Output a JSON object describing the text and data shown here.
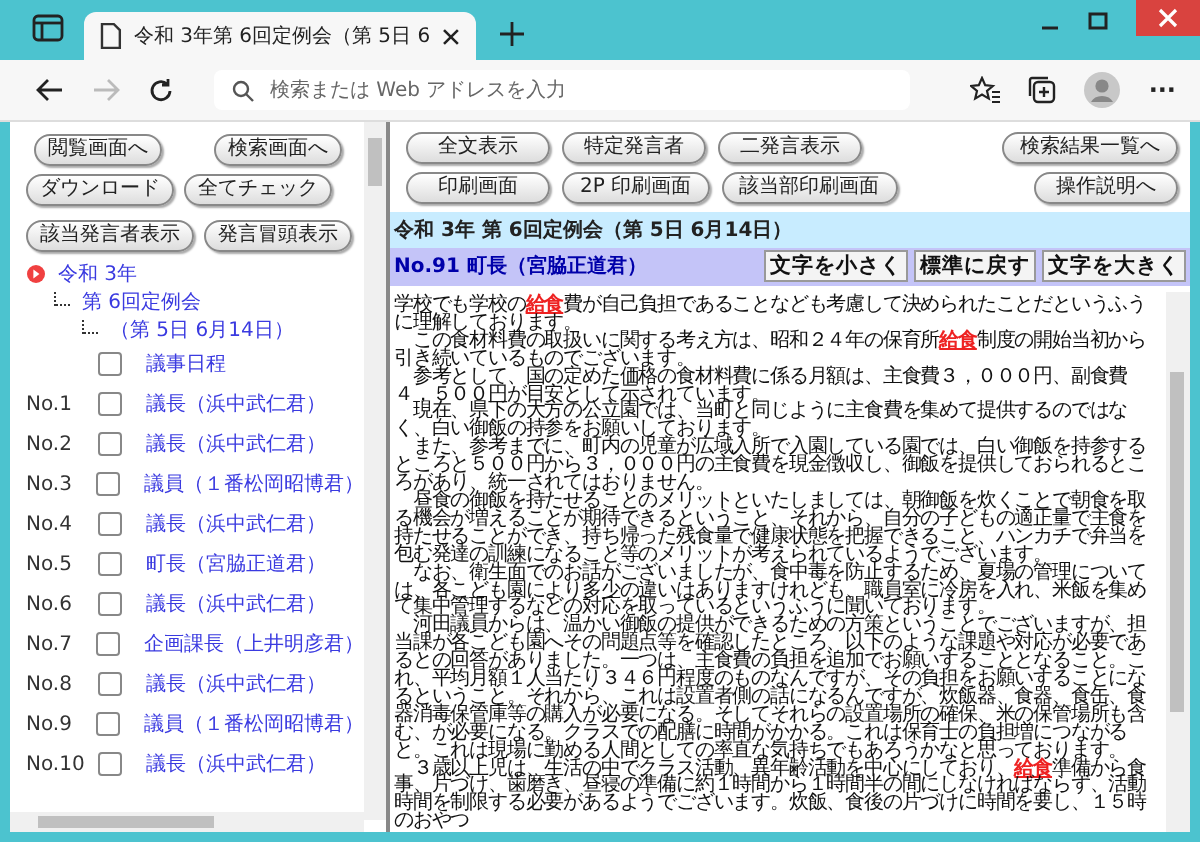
{
  "browser": {
    "tab": {
      "title": "令和 3年第 6回定例会（第 5日 6",
      "selected": true
    },
    "address": {
      "placeholder": "検索または Web アドレスを入力"
    },
    "more": "···"
  },
  "left": {
    "buttons": [
      [
        "閲覧画面へ",
        "検索画面へ"
      ],
      [
        "ダウンロード",
        "全てチェック"
      ],
      [
        "該当発言者表示",
        "発言冒頭表示"
      ]
    ],
    "tree": [
      {
        "label": "令和 3年",
        "children": [
          {
            "label": "第 6回定例会",
            "children": [
              {
                "label": "（第 5日 6月14日）"
              }
            ]
          }
        ]
      }
    ],
    "items": [
      {
        "label": "議事日程",
        "checked": false
      },
      {
        "number": "No.1",
        "label": "議長（浜中武仁君）",
        "checked": false
      },
      {
        "number": "No.2",
        "label": "議長（浜中武仁君）",
        "checked": false
      },
      {
        "number": "No.3",
        "label": "議員（１番松岡昭博君）",
        "checked": false
      },
      {
        "number": "No.4",
        "label": "議長（浜中武仁君）",
        "checked": false
      },
      {
        "number": "No.5",
        "label": "町長（宮脇正道君）",
        "checked": false
      },
      {
        "number": "No.6",
        "label": "議長（浜中武仁君）",
        "checked": false
      },
      {
        "number": "No.7",
        "label": "企画課長（上井明彦君）",
        "checked": false
      },
      {
        "number": "No.8",
        "label": "議長（浜中武仁君）",
        "checked": false
      },
      {
        "number": "No.9",
        "label": "議員（１番松岡昭博君）",
        "checked": false
      },
      {
        "number": "No.10",
        "label": "議長（浜中武仁君）",
        "checked": false
      }
    ]
  },
  "right": {
    "buttons": [
      [
        "全文表示",
        "特定発言者",
        "二発言表示"
      ],
      [
        "印刷画面",
        "2P 印刷画面",
        "該当部印刷画面"
      ]
    ],
    "side_buttons": [
      "検索結果一覧へ",
      "操作説明へ"
    ],
    "title": "令和 3年 第 6回定例会（第 5日 6月14日）",
    "speaker": "No.91 町長（宮脇正道君）",
    "size_buttons": [
      "文字を小さく",
      "標準に戻す",
      "文字を大きく"
    ],
    "paragraphs": [
      "学校でも学校の**給食**費が自己負担であることなども考慮して決められたことだというふうに理解しております。",
      "　この食材料費の取扱いに関する考え方は、昭和２４年の保育所**給食**制度の開始当初から引き続いているものでございます。",
      "　参考として、国の定めた価格の食材料費に係る月額は、主食費３，０００円、副食費４，５００円が目安として示されています。",
      "　現在、県下の大方の公立園では、当町と同じように主食費を集めて提供するのではなく、白い御飯の持参をお願いしております。",
      "　また、参考までに、町内の児童が広域入所で入園している園では、白い御飯を持参するところと５００円から３，０００円の主食費を現金徴収し、御飯を提供しておられるところがあり、統一されてはおりません。",
      "　昼食の御飯を持たせることのメリットといたしましては、朝御飯を炊くことで朝食を取る機会が増えることが期待できるということ、それから、自分の子どもの適正量で主食を持たせることができ、持ち帰った残食量で健康状態を把握できること、ハンカチで弁当を包む発達の訓練になること等のメリットが考えられているようでございます。",
      "　なお、衛生面でのお話がございましたが、食中毒を防止するため、夏場の管理については、各こども園により多少の違いはありますけれども、職員室に冷房を入れ、米飯を集めて集中管理するなどの対応を取っているというふうに聞いております。",
      "　河田議員からは、温かい御飯の提供ができるための方策ということでございますが、担当課が各こども園へその問題点等を確認したところ、以下のような課題や対応が必要であるとの回答がありました。一つは、主食費の負担を追加でお願いすることとなること。これ、平均月額１人当たり３４６円程度のものなんですが、その負担をお願いすることになるということ。それから、これは設置者側の話になるんですが、炊飯器、食器、食缶、食器消毒保管庫等の購入が必要になる。そしてそれらの設置場所の確保、米の保管場所も含む、が必要になる。クラスでの配膳に時間がかかる。これは保育士の負担増につながると。これは現場に勤める人間としての率直な気持ちでもあろうかなと思っております。",
      "　３歳以上児は、生活の中でクラス活動、異年齢活動を中心にしており、**給食**準備から食事、片づけ、歯磨き、昼寝の準備に約１時間から１時間半の間にしなければならず、活動時間を制限する必要があるようでございます。炊飯、食後の片づけに時間を要し、１５時のおやつ"
    ]
  }
}
